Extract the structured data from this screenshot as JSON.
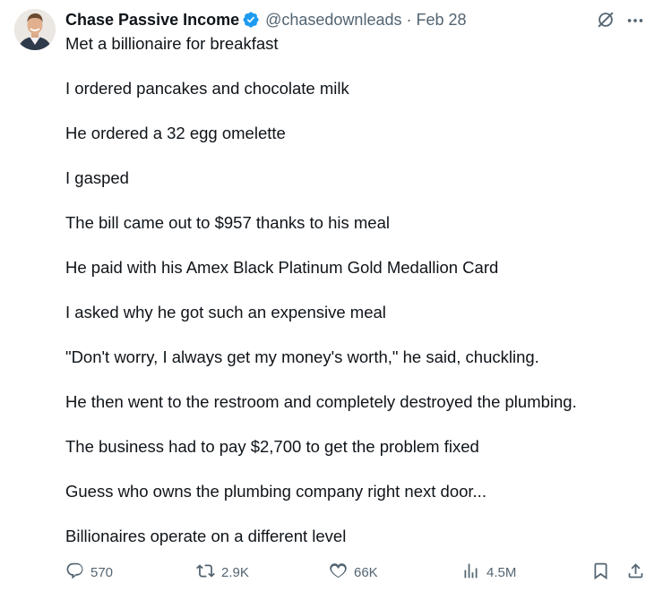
{
  "tweet": {
    "author": {
      "name": "Chase Passive Income",
      "handle": "@chasedownleads",
      "separator": "·",
      "date": "Feb 28",
      "verified_color": "#1d9bf0"
    },
    "paragraphs": [
      "Met a billionaire for breakfast",
      "I ordered pancakes and chocolate milk",
      "He ordered a 32 egg omelette",
      "I gasped",
      "The bill came out to $957 thanks to his meal",
      "He paid with his Amex Black Platinum Gold Medallion Card",
      "I asked why he got such an expensive meal",
      "\"Don't worry, I always get my money's worth,\" he said, chuckling.",
      "He then went to the restroom and completely destroyed the plumbing.",
      "The business had to pay $2,700 to get the problem fixed",
      "Guess who owns the plumbing company right next door...",
      "Billionaires operate on a different level"
    ],
    "metrics": {
      "replies": "570",
      "reposts": "2.9K",
      "likes": "66K",
      "views": "4.5M"
    },
    "icons": {
      "top_right": [
        "grok-icon",
        "more-icon"
      ],
      "actions": [
        "reply-icon",
        "repost-icon",
        "like-icon",
        "views-icon",
        "bookmark-icon",
        "share-icon"
      ]
    },
    "colors": {
      "text": "#0f1419",
      "secondary": "#536471",
      "accent": "#1d9bf0"
    }
  }
}
